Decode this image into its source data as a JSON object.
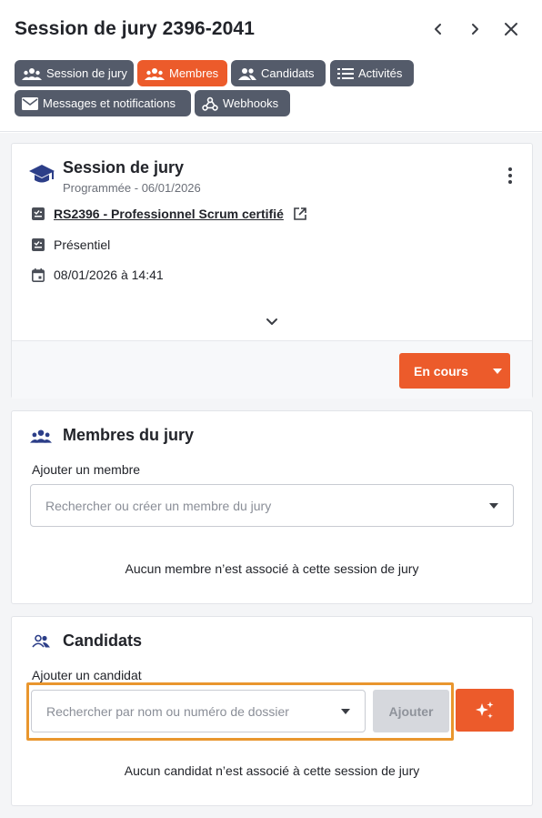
{
  "header": {
    "title": "Session de jury 2396-2041",
    "prev_icon": "chevron-left-icon",
    "next_icon": "chevron-right-icon",
    "close_icon": "close-icon"
  },
  "tabs": [
    {
      "label": "Session de jury",
      "icon": "group-icon",
      "active": false
    },
    {
      "label": "Membres",
      "icon": "group-icon",
      "active": true
    },
    {
      "label": "Candidats",
      "icon": "people-icon",
      "active": false
    },
    {
      "label": "Activités",
      "icon": "list-icon",
      "active": false
    },
    {
      "label": "Messages et notifications",
      "icon": "mail-icon",
      "active": false
    },
    {
      "label": "Webhooks",
      "icon": "webhook-icon",
      "active": false
    }
  ],
  "session_card": {
    "title": "Session de jury",
    "subtitle": "Programmée - 06/01/2026",
    "certification_link": "RS2396 - Professionnel Scrum certifié",
    "modality": "Présentiel",
    "datetime": "08/01/2026 à 14:41",
    "status_button": "En cours"
  },
  "members_card": {
    "title": "Membres du jury",
    "add_label": "Ajouter un membre",
    "search_placeholder": "Rechercher ou créer un membre du jury",
    "empty_text": "Aucun membre n’est associé à cette session de jury"
  },
  "candidates_card": {
    "title": "Candidats",
    "add_label": "Ajouter un candidat",
    "search_placeholder": "Rechercher par nom ou numéro de dossier",
    "add_button": "Ajouter",
    "empty_text": "Aucun candidat n’est associé à cette session de jury"
  },
  "colors": {
    "accent": "#ec5b2b",
    "tab_default": "#545b6a",
    "highlight": "#e9962e",
    "icon_blue": "#2c3e88"
  }
}
